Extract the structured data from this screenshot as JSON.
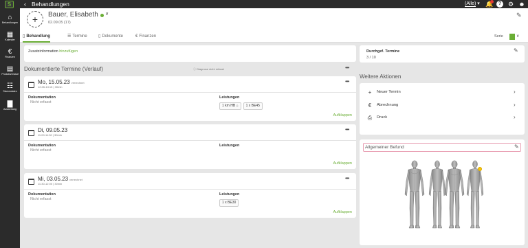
{
  "app": {
    "logo_text": "S",
    "back_icon": "chevron-left-icon",
    "title": "Behandlungen",
    "filter_label": "(Alle)",
    "filter_icon": "chevron-down-icon"
  },
  "sidebar": {
    "items": [
      {
        "icon": "home-icon",
        "label": "Behandlungen"
      },
      {
        "icon": "calendar-icon",
        "label": "Kalender"
      },
      {
        "icon": "euro-icon",
        "label": "Finanzen"
      },
      {
        "icon": "document-icon",
        "label": "Produktverkauf"
      },
      {
        "icon": "sitemap-icon",
        "label": "Stammdaten"
      },
      {
        "icon": "chart-icon",
        "label": "Auswertung"
      }
    ]
  },
  "patient": {
    "name": "Bauer, Elisabeth",
    "dob": "02.09.05 (17)",
    "status_color": "#6aae35"
  },
  "tabs": [
    {
      "label": "Behandlung",
      "icon": "bookmark-icon",
      "active": true
    },
    {
      "label": "Termine",
      "icon": "list-icon",
      "active": false
    },
    {
      "label": "Dokumente",
      "icon": "file-icon",
      "active": false
    },
    {
      "label": "Finanzen",
      "icon": "euro-icon",
      "active": false
    }
  ],
  "serie_label": "Serie",
  "zusatz": {
    "label": "Zusatzinformation",
    "action": "hinzufügen"
  },
  "section": {
    "title": "Dokumentierte Termine (Verlauf)",
    "diag_hint": "Diagnose nicht erfasst"
  },
  "appointments": [
    {
      "date": "Mo, 15.05.23",
      "status": "verrechnet",
      "time": "12:45-13:15 | 30min",
      "doc_label": "Dokumentation",
      "doc_value": "Nicht erfasst",
      "serv_label": "Leistungen",
      "services": [
        "1 km HB",
        "1 x BE45"
      ],
      "expand": "Aufklappen"
    },
    {
      "date": "Di, 09.05.23",
      "status": "",
      "time": "11:00-11:30 | 30min",
      "doc_label": "Dokumentation",
      "doc_value": "Nicht erfasst",
      "serv_label": "Leistungen",
      "services": [],
      "expand": "Aufklappen"
    },
    {
      "date": "Mi, 03.05.23",
      "status": "verrechnet",
      "time": "11:30-12:00 | 30min",
      "doc_label": "Dokumentation",
      "doc_value": "Nicht erfasst",
      "serv_label": "Leistungen",
      "services": [
        "1 x BE30"
      ],
      "expand": "Aufklappen"
    }
  ],
  "durchgef": {
    "label": "Durchgef. Termine",
    "value": "3 / 10"
  },
  "weitere": {
    "title": "Weitere Aktionen",
    "items": [
      {
        "label": "Neuer Termin",
        "icon": "plus-icon"
      },
      {
        "label": "Abrechnung",
        "icon": "euro-icon"
      },
      {
        "label": "Druck",
        "icon": "printer-icon"
      }
    ]
  },
  "befund": {
    "title": "Allgemeiner Befund"
  },
  "colors": {
    "accent": "#6aae35",
    "dark": "#2b2b2b",
    "notification": "#e53935",
    "befund_border": "#e9a0b4",
    "marker": "#f4c20d"
  }
}
